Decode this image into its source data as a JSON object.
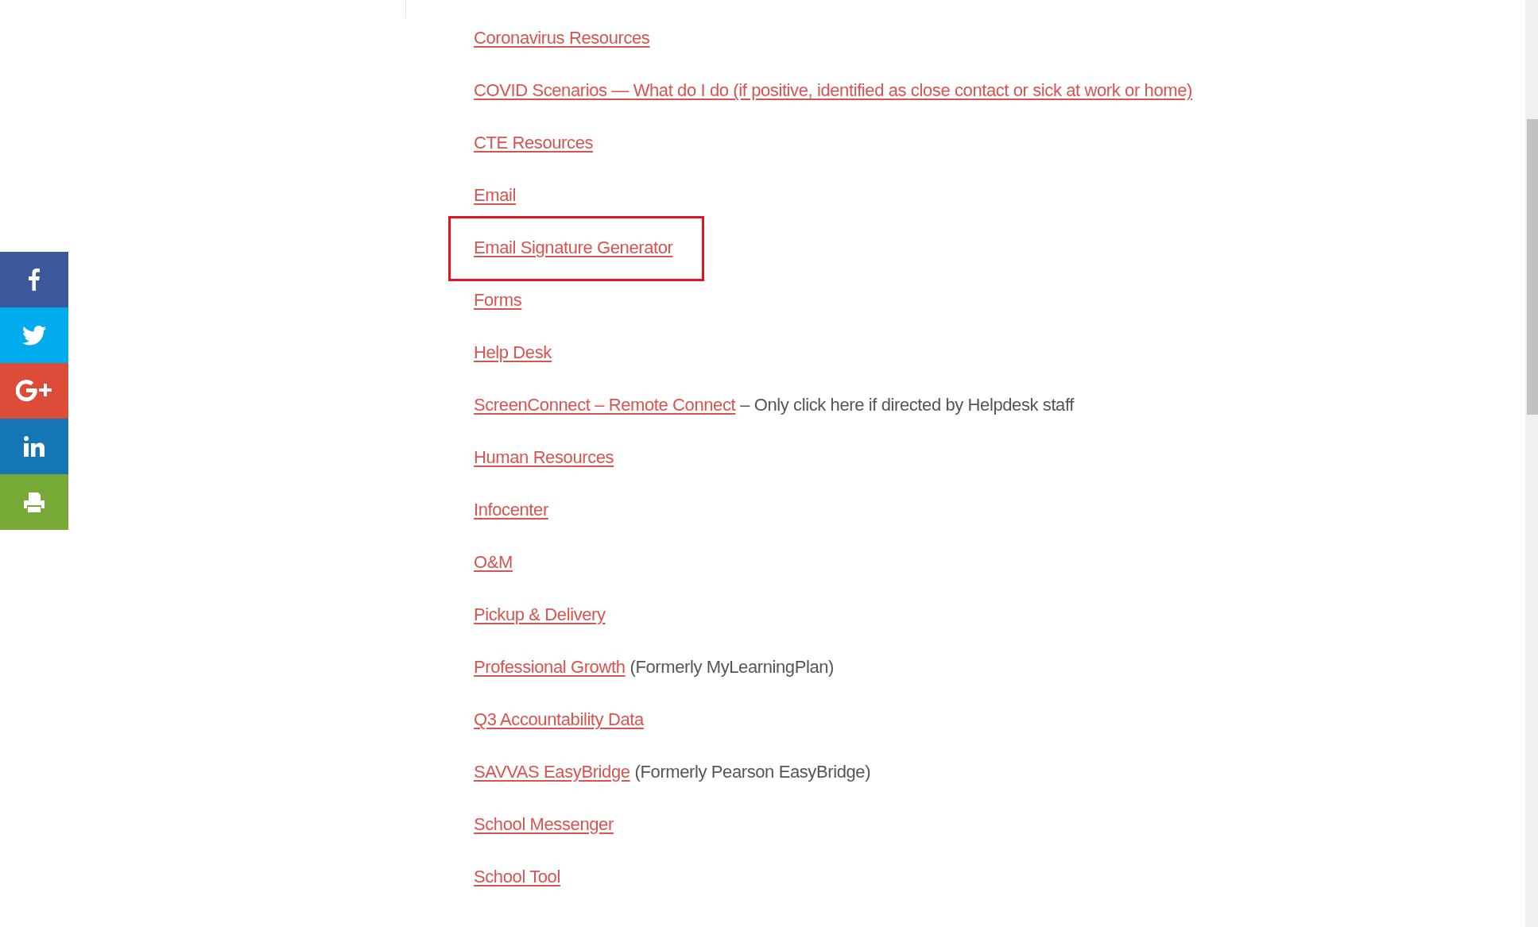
{
  "share_bar": [
    {
      "kind": "facebook",
      "color": "#3b5998"
    },
    {
      "kind": "twitter",
      "color": "#00aced"
    },
    {
      "kind": "googleplus",
      "color": "#dd4b39"
    },
    {
      "kind": "linkedin",
      "color": "#1477b4"
    },
    {
      "kind": "print",
      "color": "#76a935"
    }
  ],
  "links": [
    {
      "label": "Coronavirus Resources",
      "highlighted": false
    },
    {
      "label": "COVID Scenarios — What do I do (if positive, identified as close contact or sick at work or home)",
      "highlighted": false
    },
    {
      "label": "CTE Resources",
      "highlighted": false
    },
    {
      "label": "Email",
      "highlighted": false
    },
    {
      "label": "Email Signature Generator",
      "highlighted": true
    },
    {
      "label": "Forms",
      "highlighted": false
    },
    {
      "label": "Help Desk",
      "highlighted": false
    },
    {
      "label": "ScreenConnect – Remote Connect",
      "note": "– Only click here if directed by Helpdesk staff",
      "highlighted": false
    },
    {
      "label": "Human Resources",
      "highlighted": false
    },
    {
      "label": "Infocenter",
      "highlighted": false
    },
    {
      "label": "O&M",
      "highlighted": false
    },
    {
      "label": "Pickup & Delivery",
      "highlighted": false
    },
    {
      "label": "Professional Growth",
      "note": "(Formerly MyLearningPlan)",
      "highlighted": false
    },
    {
      "label": "Q3 Accountability Data",
      "highlighted": false
    },
    {
      "label": "SAVVAS EasyBridge",
      "note": "(Formerly Pearson EasyBridge)",
      "highlighted": false
    },
    {
      "label": "School Messenger",
      "highlighted": false
    },
    {
      "label": "School Tool",
      "highlighted": false
    }
  ]
}
